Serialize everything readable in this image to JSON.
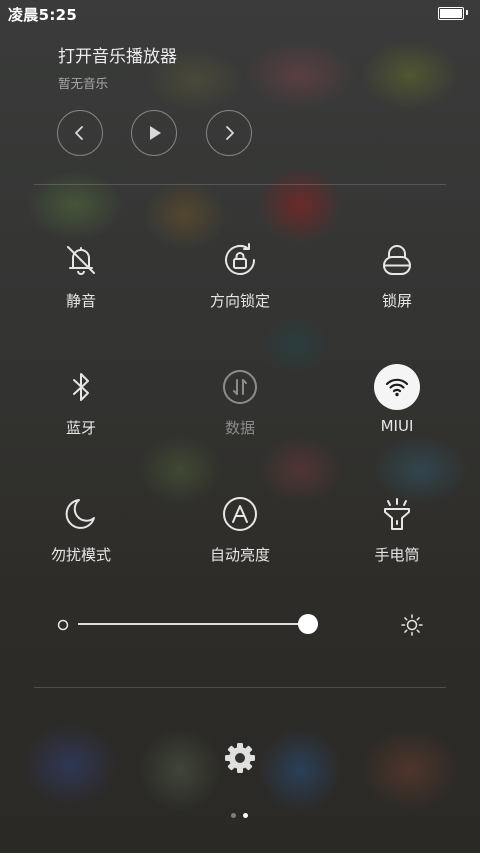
{
  "status": {
    "time": "凌晨5:25",
    "battery_level": 1.0
  },
  "music": {
    "title": "打开音乐播放器",
    "subtitle": "暂无音乐",
    "controls": [
      {
        "icon": "previous-icon"
      },
      {
        "icon": "play-icon"
      },
      {
        "icon": "next-icon"
      }
    ]
  },
  "toggles": [
    {
      "label": "静音",
      "icon": "bell-off-icon",
      "state": "off"
    },
    {
      "label": "方向锁定",
      "icon": "rotation-lock-icon",
      "state": "off"
    },
    {
      "label": "锁屏",
      "icon": "lock-icon",
      "state": "off"
    },
    {
      "label": "蓝牙",
      "icon": "bluetooth-icon",
      "state": "off"
    },
    {
      "label": "数据",
      "icon": "mobile-data-icon",
      "state": "disabled"
    },
    {
      "label": "MIUI",
      "icon": "wifi-icon",
      "state": "on"
    },
    {
      "label": "勿扰模式",
      "icon": "moon-icon",
      "state": "off"
    },
    {
      "label": "自动亮度",
      "icon": "auto-brightness-icon",
      "state": "off"
    },
    {
      "label": "手电筒",
      "icon": "flashlight-icon",
      "state": "off"
    }
  ],
  "brightness": {
    "value": 1.0,
    "min_icon": "brightness-low-icon",
    "max_icon": "brightness-high-icon"
  },
  "settings_icon": "gear-icon",
  "pages": {
    "count": 2,
    "active": 2
  },
  "colors": {
    "active_toggle_bg": "#f5f5f5",
    "text": "#e9e9e9",
    "disabled": "#8c8c8c"
  }
}
